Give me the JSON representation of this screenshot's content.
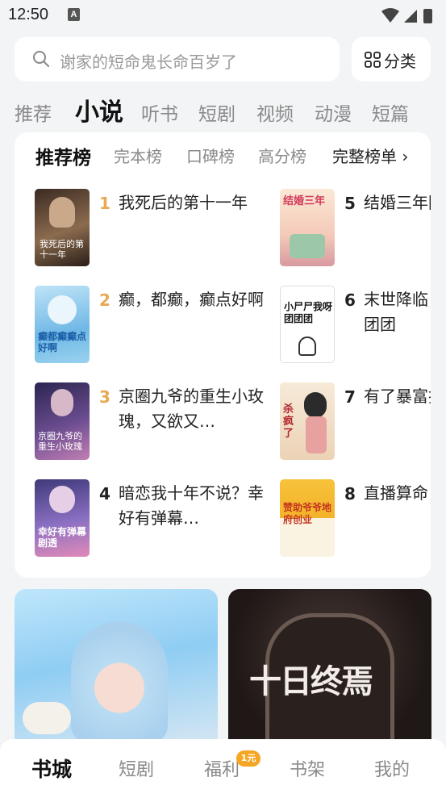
{
  "status": {
    "time": "12:50",
    "notif_letter": "A"
  },
  "search": {
    "placeholder": "谢家的短命鬼长命百岁了"
  },
  "category": {
    "label": "分类"
  },
  "top_tabs": [
    "推荐",
    "小说",
    "听书",
    "短剧",
    "视频",
    "动漫",
    "短篇"
  ],
  "active_top_tab": "小说",
  "rank_tabs": [
    "推荐榜",
    "完本榜",
    "口碑榜",
    "高分榜"
  ],
  "rank_more": "完整榜单 ›",
  "books": [
    {
      "rank": "1",
      "title": "我死后的第十一年",
      "rank_color": "#e8a951",
      "cover_text": "我死后的第十一年"
    },
    {
      "rank": "2",
      "title": "癫，都癫，癫点好啊",
      "rank_color": "#e8a951",
      "cover_text": "癫都癫癫点好啊"
    },
    {
      "rank": "3",
      "title": "京圈九爷的重生小玫瑰，又欲又…",
      "rank_color": "#e8a951",
      "cover_text": "京圈九爷的重生小玫瑰"
    },
    {
      "rank": "4",
      "title": "暗恋我十年不说？幸好有弹幕…",
      "rank_color": "#222222",
      "cover_text": "幸好有弹幕剧透"
    },
    {
      "rank": "5",
      "title": "结婚三年回家，军婚",
      "rank_color": "#222222",
      "cover_text": "结婚三年"
    },
    {
      "rank": "6",
      "title": "末世降临，丧尸我呀团团",
      "rank_color": "#222222",
      "cover_text": "小尸尸我呀团团团"
    },
    {
      "rank": "7",
      "title": "有了暴富技术，我在",
      "rank_color": "#222222",
      "cover_text": "杀疯了"
    },
    {
      "rank": "8",
      "title": "直播算命，赞助爷",
      "rank_color": "#222222",
      "cover_text": "赞助爷爷地府创业"
    }
  ],
  "banners": [
    {
      "caption": ""
    },
    {
      "caption": "十日终焉"
    }
  ],
  "nav": [
    {
      "label": "书城",
      "active": true
    },
    {
      "label": "短剧",
      "active": false
    },
    {
      "label": "福利",
      "active": false,
      "badge": "1元"
    },
    {
      "label": "书架",
      "active": false
    },
    {
      "label": "我的",
      "active": false
    }
  ],
  "colors": {
    "accent_gold": "#e8a951",
    "badge": "#f5a623"
  }
}
